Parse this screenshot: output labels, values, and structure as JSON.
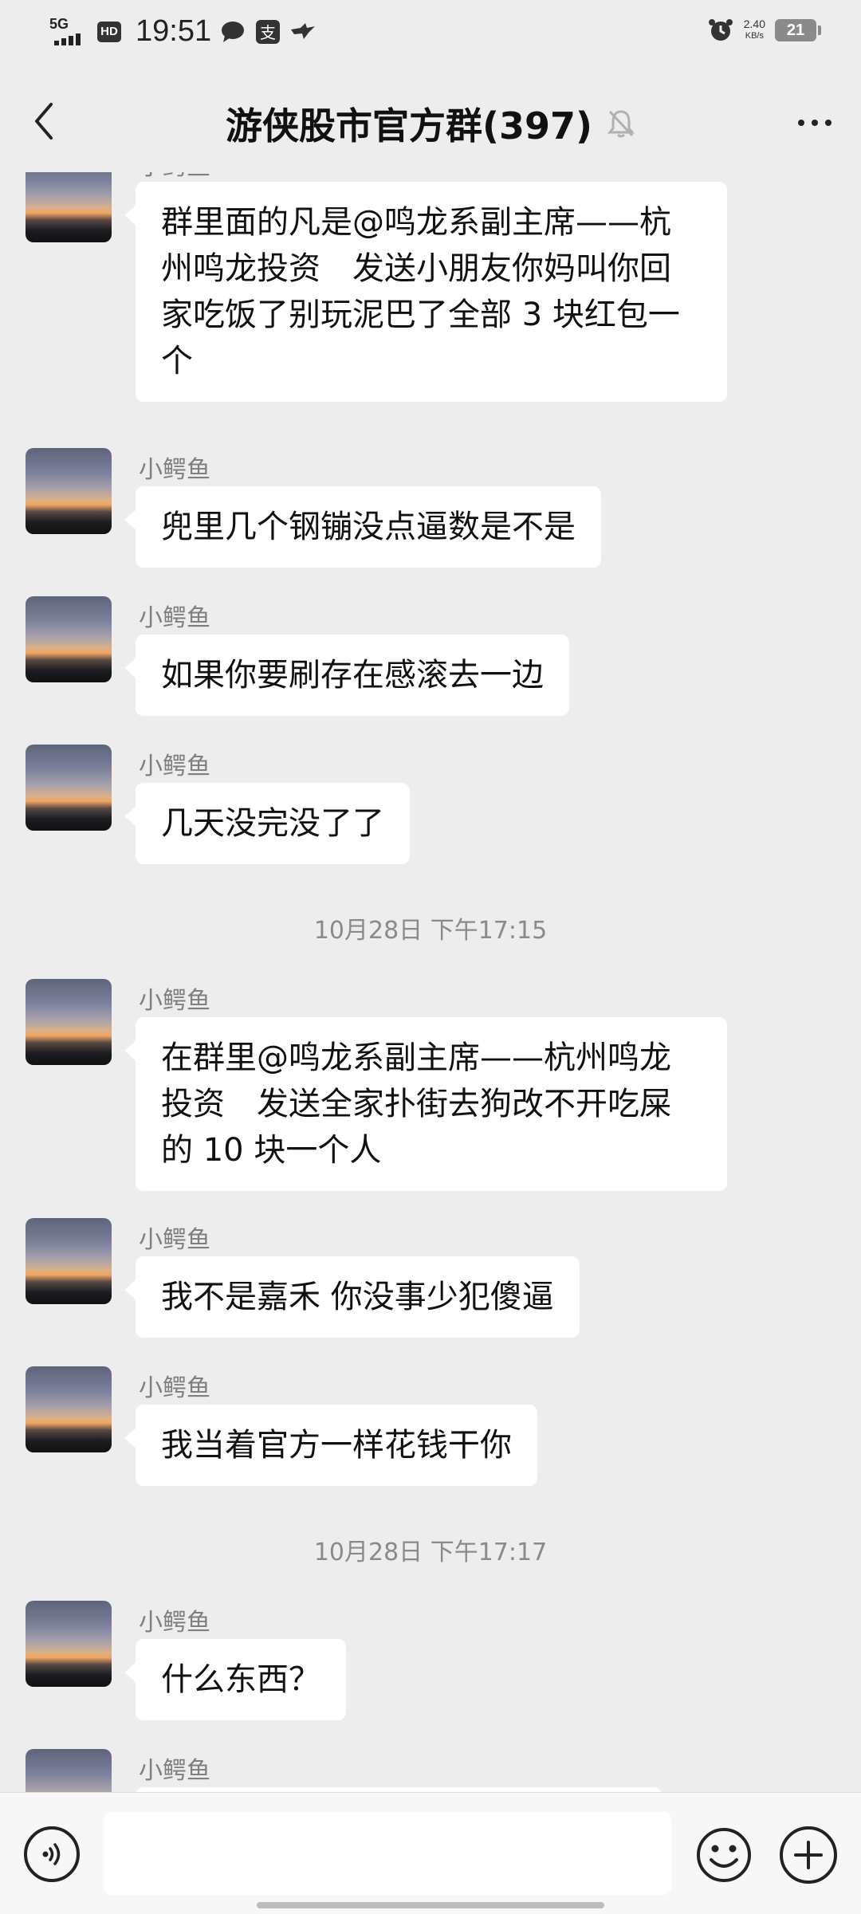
{
  "status_bar": {
    "network": "5G",
    "hd": "HD",
    "time": "19:51",
    "speed_value": "2.40",
    "speed_unit": "KB/s",
    "battery": "21",
    "icons": [
      "chat-bubble-icon",
      "alipay-icon",
      "bird-icon",
      "alarm-clock-icon"
    ]
  },
  "header": {
    "title": "游侠股市官方群(397)",
    "icons": [
      "back-arrow-icon",
      "mute-bell-icon",
      "more-dots-icon"
    ]
  },
  "messages": [
    {
      "type": "msg",
      "sender": "小鳄鱼",
      "text": "群里面的凡是@鸣龙系副主席——杭州鸣龙投资　发送小朋友你妈叫你回家吃饭了别玩泥巴了全部 3 块红包一个"
    },
    {
      "type": "msg",
      "sender": "小鳄鱼",
      "text": "兜里几个钢镚没点逼数是不是"
    },
    {
      "type": "msg",
      "sender": "小鳄鱼",
      "text": "如果你要刷存在感滚去一边"
    },
    {
      "type": "msg",
      "sender": "小鳄鱼",
      "text": "几天没完没了了"
    },
    {
      "type": "time",
      "text": "10月28日 下午17:15"
    },
    {
      "type": "msg",
      "sender": "小鳄鱼",
      "text": "在群里@鸣龙系副主席——杭州鸣龙投资　发送全家扑街去狗改不开吃屎的 10 块一个人"
    },
    {
      "type": "msg",
      "sender": "小鳄鱼",
      "text": "我不是嘉禾 你没事少犯傻逼"
    },
    {
      "type": "msg",
      "sender": "小鳄鱼",
      "text": "我当着官方一样花钱干你"
    },
    {
      "type": "time",
      "text": "10月28日 下午17:17"
    },
    {
      "type": "msg",
      "sender": "小鳄鱼",
      "text": "什么东西？"
    },
    {
      "type": "msg",
      "sender": "小鳄鱼",
      "text": ""
    }
  ],
  "input_bar": {
    "message_value": "",
    "icons": [
      "voice-icon",
      "emoji-icon",
      "plus-icon"
    ]
  }
}
